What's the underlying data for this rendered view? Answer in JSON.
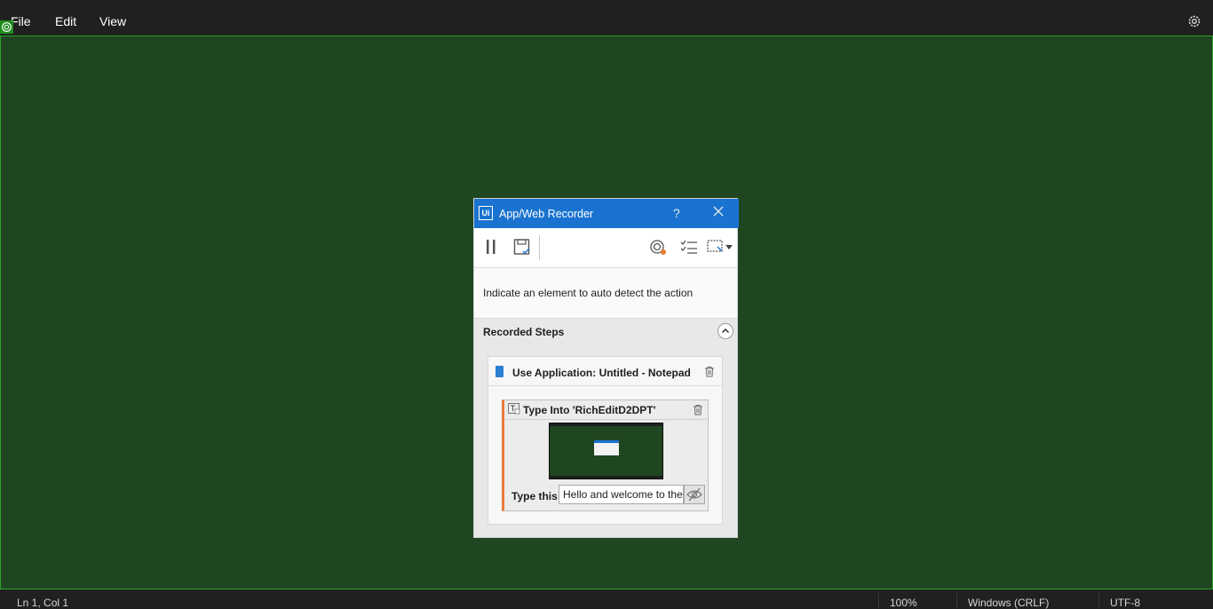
{
  "menubar": {
    "file_label": "File",
    "edit_label": "Edit",
    "view_label": "View"
  },
  "editor": {
    "highlight_color": "#2aa22a",
    "background": "#1f4620"
  },
  "statusbar": {
    "position": "Ln 1, Col 1",
    "zoom": "100%",
    "line_ending": "Windows (CRLF)",
    "encoding": "UTF-8"
  },
  "recorder": {
    "logo": "Ui",
    "title": "App/Web Recorder",
    "help": "?",
    "accent_color": "#1a73d0",
    "hint": "Indicate an element to auto detect the action",
    "steps_title": "Recorded Steps",
    "use_app_title": "Use Application: Untitled - Notepad",
    "type_into_title": "Type Into 'RichEditD2DPT'",
    "type_label": "Type this",
    "type_value": "Hello and welcome to the",
    "toolbar_icons": [
      "pause-icon",
      "save-icon",
      "target-icon",
      "checklist-icon",
      "screen-select-icon"
    ]
  }
}
